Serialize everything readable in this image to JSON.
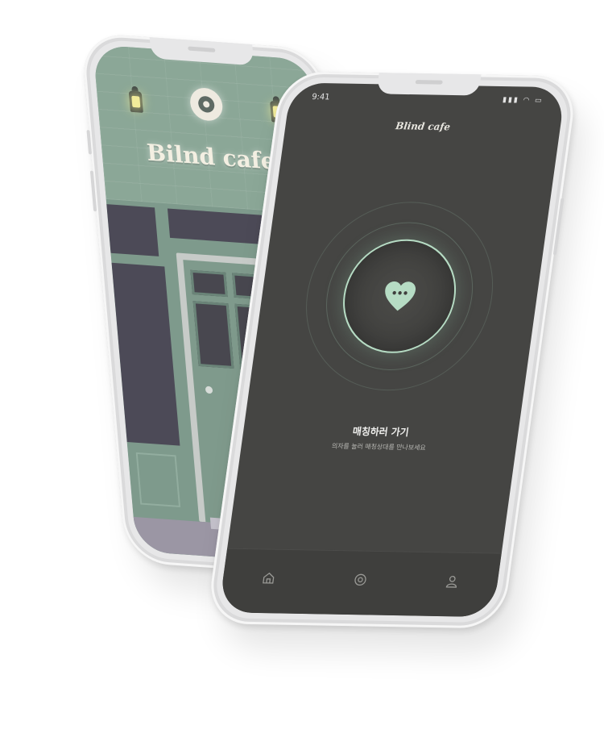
{
  "storefront": {
    "sign_text": "Bilnd cafe"
  },
  "matching_screen": {
    "status_bar": {
      "time": "9:41",
      "icons": "signal-icon wifi-icon battery-icon"
    },
    "app_title": "Blind cafe",
    "match_button_icon": "heart-chat-icon",
    "cta_title": "매칭하러 가기",
    "cta_subtitle": "의자를 눌러 매칭상대를 만나보세요",
    "tabbar": [
      {
        "icon": "home-icon"
      },
      {
        "icon": "logo-icon"
      },
      {
        "icon": "profile-icon"
      }
    ]
  },
  "colors": {
    "mint_accent": "#b6dcc4",
    "storefront_green": "#8aa597",
    "screen_dark": "#454543"
  }
}
